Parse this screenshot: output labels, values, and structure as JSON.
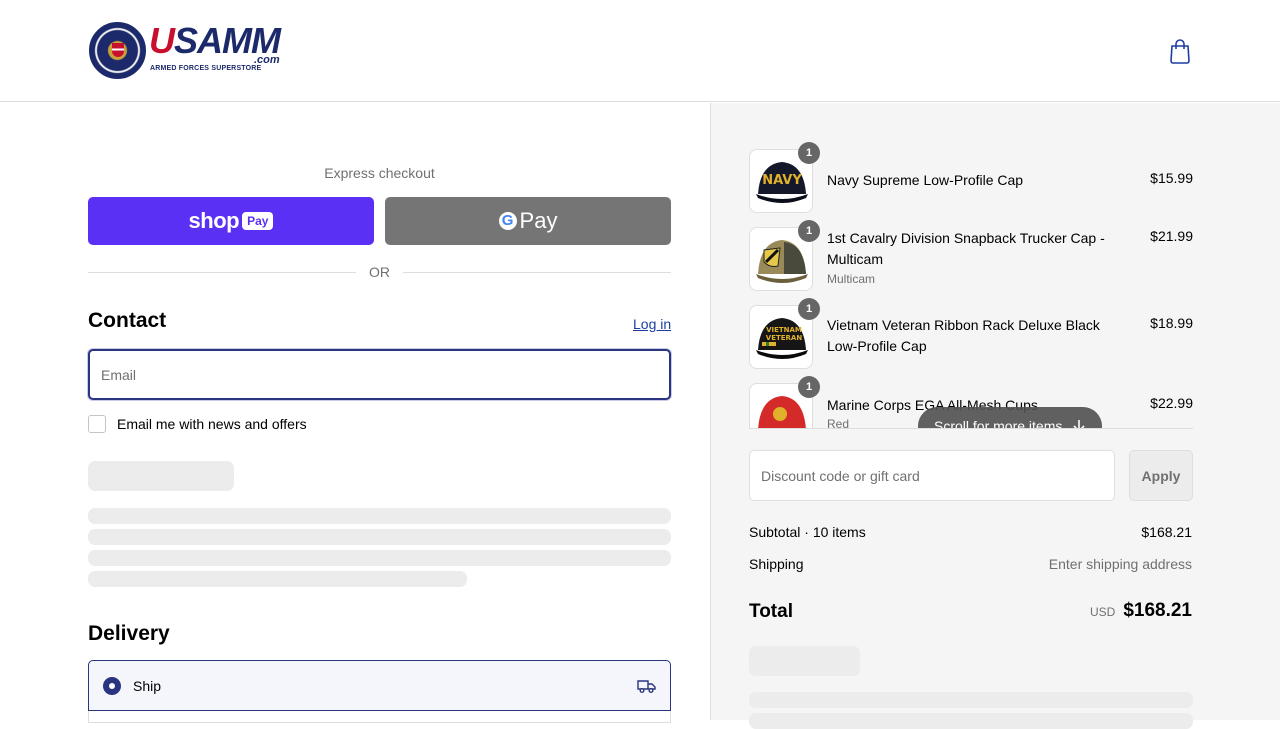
{
  "header": {
    "logo": {
      "brand": "USAMM",
      "domain": ".com",
      "tagline": "ARMED FORCES SUPERSTORE"
    },
    "cart_icon": "shopping-bag-icon"
  },
  "checkout": {
    "express_label": "Express checkout",
    "shop_pay": {
      "shop": "shop",
      "pay": "Pay"
    },
    "google_pay": {
      "g": "G",
      "pay": "Pay"
    },
    "or_label": "OR",
    "contact": {
      "title": "Contact",
      "login_label": "Log in",
      "email_placeholder": "Email",
      "newsletter_label": "Email me with news and offers"
    },
    "delivery": {
      "title": "Delivery",
      "ship_label": "Ship",
      "ship_icon": "truck-icon"
    }
  },
  "summary": {
    "items": [
      {
        "qty": "1",
        "name": "Navy Supreme Low-Profile Cap",
        "variant": "",
        "price": "$15.99"
      },
      {
        "qty": "1",
        "name": "1st Cavalry Division Snapback Trucker Cap - Multicam",
        "variant": "Multicam",
        "price": "$21.99"
      },
      {
        "qty": "1",
        "name": "Vietnam Veteran Ribbon Rack Deluxe Black Low-Profile Cap",
        "variant": "",
        "price": "$18.99"
      },
      {
        "qty": "1",
        "name": "Marine Corps EGA All-Mesh Cups",
        "variant": "Red",
        "price": "$22.99"
      }
    ],
    "scroll_hint": "Scroll for more items",
    "discount_placeholder": "Discount code or gift card",
    "apply_label": "Apply",
    "subtotal_label": "Subtotal · 10 items",
    "subtotal_value": "$168.21",
    "shipping_label": "Shipping",
    "shipping_value": "Enter shipping address",
    "total_label": "Total",
    "currency": "USD",
    "total_value": "$168.21"
  },
  "colors": {
    "shop_pay": "#5a31f4",
    "google_pay_bg": "#757575",
    "focus_border": "#2a3580",
    "link": "#1c3ea3",
    "sidebar_bg": "#f5f5f5"
  }
}
